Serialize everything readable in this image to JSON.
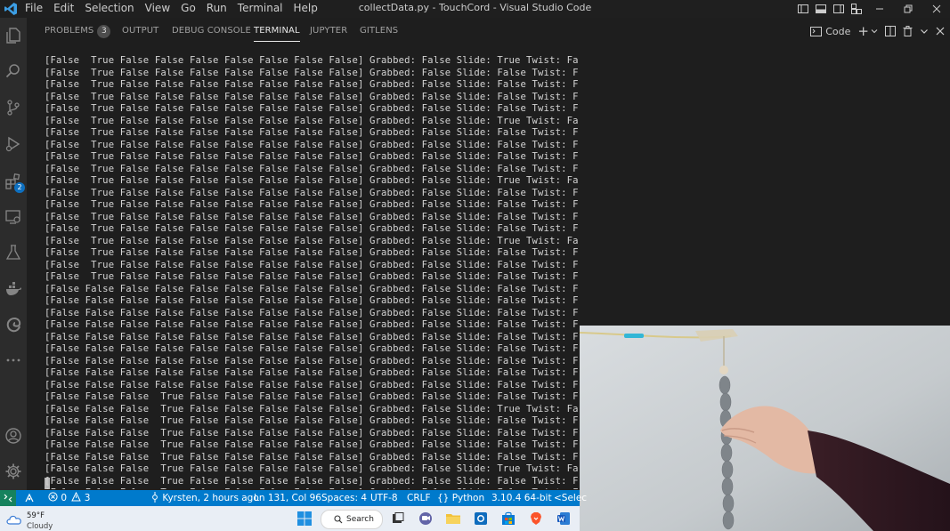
{
  "titlebar": {
    "menu": [
      "File",
      "Edit",
      "Selection",
      "View",
      "Go",
      "Run",
      "Terminal",
      "Help"
    ],
    "window_title": "collectData.py - TouchCord - Visual Studio Code"
  },
  "activity_bar": {
    "extensions_badge": "2"
  },
  "panel": {
    "tabs": [
      {
        "label": "PROBLEMS",
        "badge": "3"
      },
      {
        "label": "OUTPUT"
      },
      {
        "label": "DEBUG CONSOLE"
      },
      {
        "label": "TERMINAL"
      },
      {
        "label": "JUPYTER"
      },
      {
        "label": "GITLENS"
      }
    ],
    "active_tab": "TERMINAL",
    "actions": {
      "terminal_profile": "Code"
    }
  },
  "terminal": {
    "lines": [
      "[False  True False False False False False False False] Grabbed: False Slide: True Twist: False",
      "[False  True False False False False False False False] Grabbed: False Slide: False Twist: False",
      "[False  True False False False False False False False] Grabbed: False Slide: False Twist: False",
      "[False  True False False False False False False False] Grabbed: False Slide: False Twist: False",
      "[False  True False False False False False False False] Grabbed: False Slide: False Twist: False",
      "[False  True False False False False False False False] Grabbed: False Slide: True Twist: False",
      "[False  True False False False False False False False] Grabbed: False Slide: False Twist: False",
      "[False  True False False False False False False False] Grabbed: False Slide: False Twist: False",
      "[False  True False False False False False False False] Grabbed: False Slide: False Twist: False",
      "[False  True False False False False False False False] Grabbed: False Slide: False Twist: False",
      "[False  True False False False False False False False] Grabbed: False Slide: True Twist: False",
      "[False  True False False False False False False False] Grabbed: False Slide: False Twist: False",
      "[False  True False False False False False False False] Grabbed: False Slide: False Twist: False",
      "[False  True False False False False False False False] Grabbed: False Slide: False Twist: False",
      "[False  True False False False False False False False] Grabbed: False Slide: False Twist: False",
      "[False  True False False False False False False False] Grabbed: False Slide: True Twist: False",
      "[False  True False False False False False False False] Grabbed: False Slide: False Twist: False",
      "[False  True False False False False False False False] Grabbed: False Slide: False Twist: False",
      "[False  True False False False False False False False] Grabbed: False Slide: False Twist: False",
      "[False False False False False False False False False] Grabbed: False Slide: False Twist: False",
      "[False False False False False False False False False] Grabbed: False Slide: False Twist: False",
      "[False False False False False False False False False] Grabbed: False Slide: False Twist: False",
      "[False False False False False False False False False] Grabbed: False Slide: False Twist: False",
      "[False False False False False False False False False] Grabbed: False Slide: False Twist: False",
      "[False False False False False False False False False] Grabbed: False Slide: False Twist: False",
      "[False False False False False False False False False] Grabbed: False Slide: False Twist: False",
      "[False False False False False False False False False] Grabbed: False Slide: False Twist: False",
      "[False False False False False False False False False] Grabbed: False Slide: False Twist: False",
      "[False False False  True False False False False False] Grabbed: False Slide: False Twist: False",
      "[False False False  True False False False False False] Grabbed: False Slide: True Twist: False",
      "[False False False  True False False False False False] Grabbed: False Slide: False Twist: False",
      "[False False False  True False False False False False] Grabbed: False Slide: False Twist: False",
      "[False False False  True False False False False False] Grabbed: False Slide: False Twist: False",
      "[False False False  True False False False False False] Grabbed: False Slide: False Twist: False",
      "[False False False  True False False False False False] Grabbed: False Slide: True Twist: False",
      "[False False False  True False False False False False] Grabbed: False Slide: False Twist: False",
      "[False False False  True False False False False False] Grabbed: False Slide: False Twist: False"
    ]
  },
  "statusbar": {
    "problems_errors": "0",
    "problems_warnings": "3",
    "blame": "Kyrsten, 2 hours ago",
    "cursor_position": "Ln 131, Col 96",
    "indentation": "Spaces: 4",
    "encoding": "UTF-8",
    "line_endings": "CRLF",
    "language": "Python",
    "interpreter": "3.10.4 64-bit",
    "truncated_item": "<Selec"
  },
  "taskbar": {
    "weather_temp": "59°F",
    "weather_condition": "Cloudy",
    "search_label": "Search"
  },
  "colors": {
    "statusbar": "#007acc",
    "remote_indicator": "#16825d",
    "terminal_bg": "#1e1e1e",
    "activity_bar": "#2c2c2c",
    "taskbar": "#e9eef5"
  }
}
